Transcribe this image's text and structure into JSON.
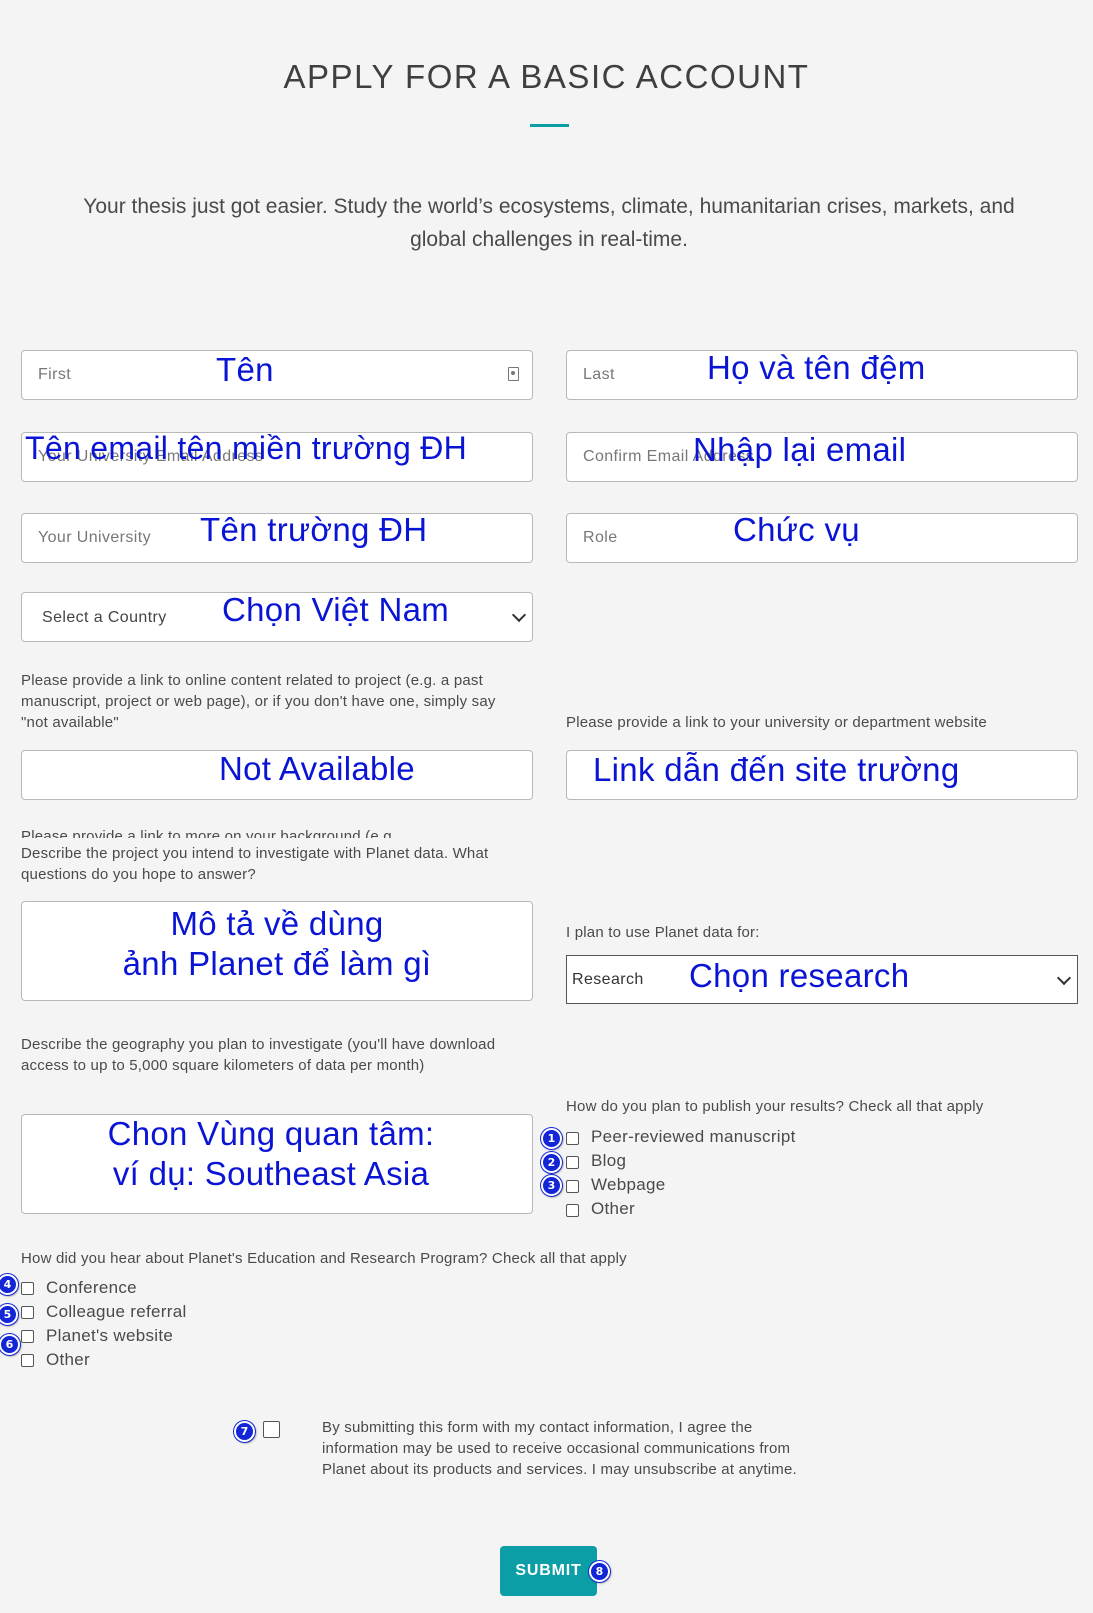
{
  "page": {
    "title": "APPLY FOR A BASIC ACCOUNT",
    "intro": "Your thesis just got easier. Study the world’s ecosystems, climate, humanitarian crises, markets, and global challenges in real-time."
  },
  "fields": {
    "first": {
      "placeholder": "First",
      "annotation": "Tên"
    },
    "last": {
      "placeholder": "Last",
      "annotation": "Họ và tên đệm"
    },
    "email": {
      "placeholder": "Your University Email Address",
      "annotation": "Tên email tên miền trường ĐH"
    },
    "confirm_email": {
      "placeholder": "Confirm Email Address",
      "annotation": "Nhập lại email"
    },
    "university": {
      "placeholder": "Your University",
      "annotation": "Tên trường ĐH"
    },
    "role": {
      "placeholder": "Role",
      "annotation": "Chức vụ"
    },
    "country": {
      "selected": "Select a Country",
      "annotation": "Chọn Việt Nam"
    },
    "project_link": {
      "label": "Please provide a link to online content related to project (e.g. a past manuscript, project or web page), or if you don't have one, simply say \"not available\"",
      "annotation": "Not Available"
    },
    "university_link": {
      "label": "Please provide a link to your university or department website",
      "annotation": "Link dẫn đến site trường"
    },
    "background_label_partial": "Please provide a link to more on your background (e.g.",
    "project_description": {
      "label": "Describe the project you intend to investigate with Planet data. What questions do you hope to answer?",
      "annotation_line1": "Mô tả về dùng",
      "annotation_line2": "ảnh Planet để làm gì"
    },
    "usage": {
      "label": "I plan to use Planet data for:",
      "selected": "Research",
      "annotation": "Chọn research"
    },
    "geography": {
      "label": "Describe the geography you plan to investigate (you'll have download access to up to 5,000 square kilometers of data per month)",
      "annotation_line1": "Chon Vùng quan tâm:",
      "annotation_line2": "ví dụ: Southeast Asia"
    }
  },
  "publish": {
    "label": "How do you plan to publish your results? Check all that apply",
    "options": [
      "Peer-reviewed manuscript",
      "Blog",
      "Webpage",
      "Other"
    ]
  },
  "hear": {
    "label": "How did you hear about Planet's Education and Research Program? Check all that apply",
    "options": [
      "Conference",
      "Colleague referral",
      "Planet's website",
      "Other"
    ]
  },
  "consent": {
    "text": "By submitting this form with my contact information, I agree the information may be used to receive occasional communications from Planet about its products and services. I may unsubscribe at anytime."
  },
  "submit_label": "SUBMIT",
  "badges": [
    "1",
    "2",
    "3",
    "4",
    "5",
    "6",
    "7",
    "8"
  ],
  "colors": {
    "accent": "#0b9ea6",
    "annotation": "#0a14d4",
    "badge": "#1326d6"
  }
}
